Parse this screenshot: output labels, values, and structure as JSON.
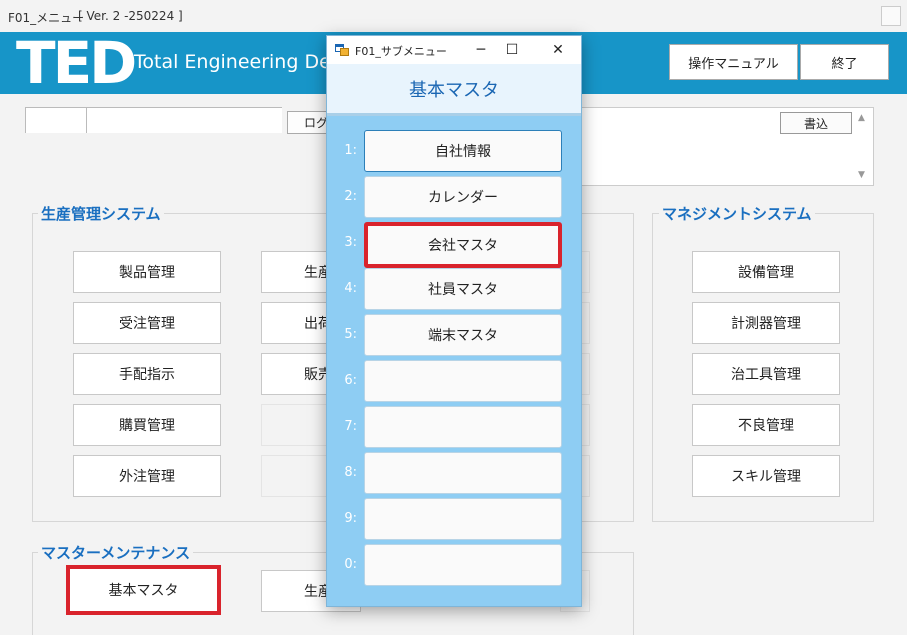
{
  "window": {
    "title": "F01_メニュー",
    "version": "[ Ver. 2 -250224 ]"
  },
  "banner": {
    "logo": "TED",
    "tagline": "Total Engineering Desi",
    "manual_button": "操作マニュアル",
    "exit_button": "終了"
  },
  "log": {
    "button_partial": "ログ",
    "write_button": "書込"
  },
  "production": {
    "title": "生産管理システム",
    "col1": [
      "製品管理",
      "受注管理",
      "手配指示",
      "購買管理",
      "外注管理"
    ],
    "col2_partial": [
      "生産",
      "出荷",
      "販売"
    ]
  },
  "management": {
    "title": "マネジメントシステム",
    "items": [
      "設備管理",
      "計測器管理",
      "治工具管理",
      "不良管理",
      "スキル管理"
    ]
  },
  "master": {
    "title": "マスターメンテナンス",
    "items": [
      "基本マスタ",
      "生産"
    ]
  },
  "submenu": {
    "window_title": "F01_サブメニュー",
    "header": "基本マスタ",
    "minimize_icon": "─",
    "maximize_icon": "☐",
    "close_icon": "✕",
    "items": [
      {
        "num": "1:",
        "label": "自社情報"
      },
      {
        "num": "2:",
        "label": "カレンダー"
      },
      {
        "num": "3:",
        "label": "会社マスタ"
      },
      {
        "num": "4:",
        "label": "社員マスタ"
      },
      {
        "num": "5:",
        "label": "端末マスタ"
      },
      {
        "num": "6:",
        "label": ""
      },
      {
        "num": "7:",
        "label": ""
      },
      {
        "num": "8:",
        "label": ""
      },
      {
        "num": "9:",
        "label": ""
      },
      {
        "num": "0:",
        "label": ""
      }
    ]
  },
  "colors": {
    "banner": "#1795c8",
    "group_title": "#1a6fc0",
    "highlight": "#d9232c",
    "dialog_bg": "#8ecdf3"
  }
}
